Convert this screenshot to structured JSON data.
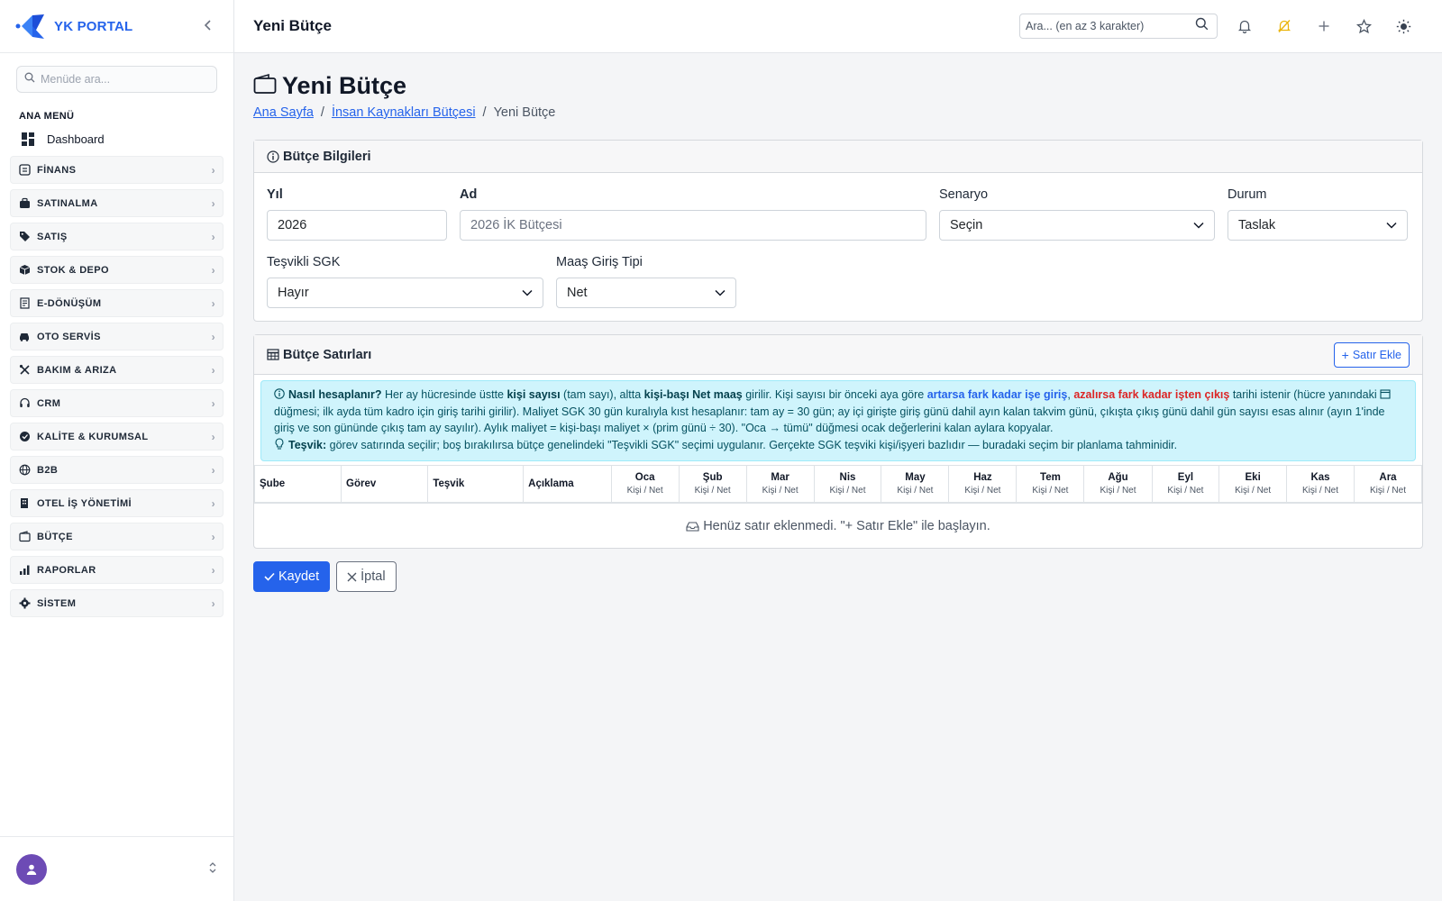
{
  "brand": {
    "name": "YK PORTAL"
  },
  "sidebar": {
    "search_placeholder": "Menüde ara...",
    "section": "ANA MENÜ",
    "dashboard": "Dashboard",
    "items": [
      {
        "label": "FİNANS",
        "icon": "finance-icon"
      },
      {
        "label": "SATINALMA",
        "icon": "briefcase-icon"
      },
      {
        "label": "SATIŞ",
        "icon": "tag-icon"
      },
      {
        "label": "STOK & DEPO",
        "icon": "box-icon"
      },
      {
        "label": "E-DÖNÜŞÜM",
        "icon": "receipt-icon"
      },
      {
        "label": "OTO SERVİS",
        "icon": "car-icon"
      },
      {
        "label": "BAKIM & ARIZA",
        "icon": "tools-icon"
      },
      {
        "label": "CRM",
        "icon": "headset-icon"
      },
      {
        "label": "KALİTE & KURUMSAL",
        "icon": "award-icon"
      },
      {
        "label": "B2B",
        "icon": "globe-icon"
      },
      {
        "label": "OTEL İŞ YÖNETİMİ",
        "icon": "building-icon"
      },
      {
        "label": "BÜTÇE",
        "icon": "wallet-icon"
      },
      {
        "label": "RAPORLAR",
        "icon": "bar-chart-icon"
      },
      {
        "label": "SİSTEM",
        "icon": "gear-icon"
      }
    ]
  },
  "topbar": {
    "title": "Yeni Bütçe",
    "search_placeholder": "Ara... (en az 3 karakter)"
  },
  "page": {
    "title": "Yeni Bütçe",
    "breadcrumb": [
      "Ana Sayfa",
      "İnsan Kaynakları Bütçesi",
      "Yeni Bütçe"
    ]
  },
  "info_card": {
    "title": "Bütçe Bilgileri",
    "year_label": "Yıl",
    "year_value": "2026",
    "name_label": "Ad",
    "name_placeholder": "2026 İK Bütçesi",
    "scenario_label": "Senaryo",
    "scenario_value": "Seçin",
    "status_label": "Durum",
    "status_value": "Taslak",
    "sgk_label": "Teşvikli SGK",
    "sgk_value": "Hayır",
    "salary_label": "Maaş Giriş Tipi",
    "salary_value": "Net"
  },
  "lines_card": {
    "title": "Bütçe Satırları",
    "add_button": "Satır Ekle",
    "info": {
      "q": "Nasıl hesaplanır?",
      "t1": " Her ay hücresinde üstte ",
      "b1": "kişi sayısı",
      "t2": " (tam sayı), altta ",
      "b2": "kişi-başı Net maaş",
      "t3": " girilir. Kişi sayısı bir önceki aya göre ",
      "blue": "artarsa fark kadar işe giriş",
      "comma": ", ",
      "red": "azalırsa fark kadar işten çıkış",
      "t4": " tarihi istenir (hücre yanındaki ",
      "t5": " düğmesi; ilk ayda tüm kadro için giriş tarihi girilir). Maliyet SGK 30 gün kuralıyla kıst hesaplanır: tam ay = 30 gün; ay içi girişte giriş günü dahil ayın kalan takvim günü, çıkışta çıkış günü dahil gün sayısı esas alınır (ayın 1'inde giriş ve son gününde çıkış tam ay sayılır). Aylık maliyet = kişi-başı maliyet × (prim günü ÷ 30). \"Oca → tümü\" düğmesi ocak değerlerini kalan aylara kopyalar.",
      "tip_b": "Teşvik:",
      "tip": " görev satırında seçilir; boş bırakılırsa bütçe genelindeki \"Teşvikli SGK\" seçimi uygulanır. Gerçekte SGK teşviki kişi/işyeri bazlıdır — buradaki seçim bir planlama tahminidir."
    },
    "columns": [
      "Şube",
      "Görev",
      "Teşvik",
      "Açıklama"
    ],
    "months": [
      "Oca",
      "Şub",
      "Mar",
      "Nis",
      "May",
      "Haz",
      "Tem",
      "Ağu",
      "Eyl",
      "Eki",
      "Kas",
      "Ara"
    ],
    "month_sub": "Kişi / Net",
    "empty": "Henüz satır eklenmedi. \"+ Satır Ekle\" ile başlayın."
  },
  "actions": {
    "save": "Kaydet",
    "cancel": "İptal"
  },
  "colors": {
    "accent": "#2563eb",
    "info_bg": "#cff4fc",
    "avatar": "#6d4bb5"
  }
}
